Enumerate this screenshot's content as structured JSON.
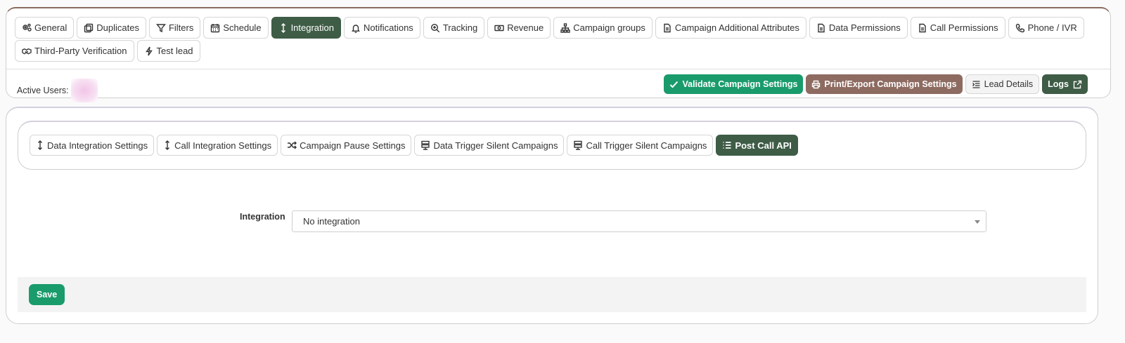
{
  "top_tabs_row1": [
    {
      "label": "General",
      "icon": "gears-icon"
    },
    {
      "label": "Duplicates",
      "icon": "copy-icon"
    },
    {
      "label": "Filters",
      "icon": "filter-icon"
    },
    {
      "label": "Schedule",
      "icon": "calendar-icon"
    },
    {
      "label": "Integration",
      "icon": "arrows-vertical-icon",
      "active": true
    },
    {
      "label": "Notifications",
      "icon": "bell-icon"
    },
    {
      "label": "Tracking",
      "icon": "zoom-icon"
    },
    {
      "label": "Revenue",
      "icon": "money-icon"
    },
    {
      "label": "Campaign groups",
      "icon": "sitemap-icon"
    },
    {
      "label": "Campaign Additional Attributes",
      "icon": "document-icon"
    },
    {
      "label": "Data Permissions",
      "icon": "document-icon"
    },
    {
      "label": "Call Permissions",
      "icon": "document-icon"
    },
    {
      "label": "Phone / IVR",
      "icon": "phone-icon"
    }
  ],
  "top_tabs_row2": [
    {
      "label": "Third-Party Verification",
      "icon": "handshake-icon"
    },
    {
      "label": "Test lead",
      "icon": "bolt-icon"
    }
  ],
  "active_users_label": "Active Users:",
  "actions": {
    "validate": "Validate Campaign Settings",
    "print": "Print/Export Campaign Settings",
    "lead_details": "Lead Details",
    "logs": "Logs"
  },
  "sub_tabs": [
    {
      "label": "Data Integration Settings",
      "icon": "arrows-vertical-icon"
    },
    {
      "label": "Call Integration Settings",
      "icon": "arrows-vertical-icon"
    },
    {
      "label": "Campaign Pause Settings",
      "icon": "shuffle-icon"
    },
    {
      "label": "Data Trigger Silent Campaigns",
      "icon": "server-icon"
    },
    {
      "label": "Call Trigger Silent Campaigns",
      "icon": "server-icon"
    },
    {
      "label": "Post Call API",
      "icon": "list-icon",
      "active": true
    }
  ],
  "form": {
    "integration_label": "Integration",
    "integration_value": "No integration"
  },
  "save_label": "Save",
  "colors": {
    "accent_dark_green": "#3e5c46",
    "accent_green": "#1a9b6c",
    "accent_brown": "#8d6b61"
  }
}
